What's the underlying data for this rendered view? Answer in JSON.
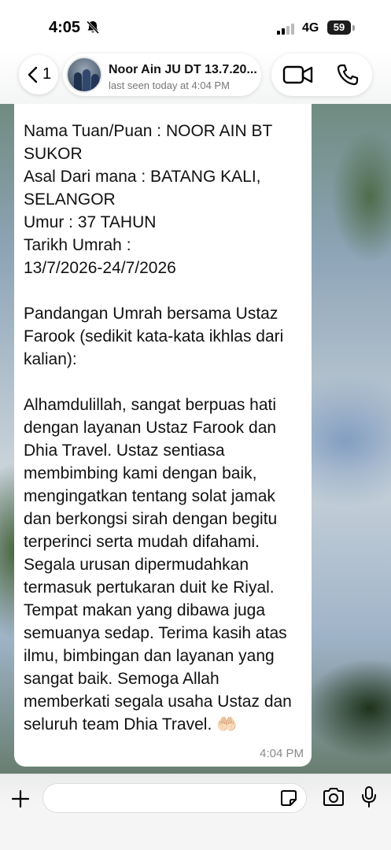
{
  "status_bar": {
    "time": "4:05",
    "network": "4G",
    "battery": "59"
  },
  "header": {
    "back_count": "1",
    "contact_name": "Noor Ain JU DT 13.7.20...",
    "contact_status": "last seen today at 4:04 PM"
  },
  "message": {
    "text": "Nama Tuan/Puan : NOOR AIN BT SUKOR\nAsal Dari mana : BATANG KALI, SELANGOR\nUmur : 37 TAHUN\nTarikh Umrah :\n13/7/2026-24/7/2026\n\nPandangan Umrah bersama Ustaz Farook (sedikit kata-kata ikhlas dari kalian):\n\nAlhamdulillah, sangat berpuas hati dengan layanan Ustaz Farook dan Dhia Travel. Ustaz sentiasa membimbing kami dengan baik, mengingatkan tentang solat jamak dan berkongsi sirah dengan begitu terperinci serta mudah difahami. Segala urusan dipermudahkan termasuk pertukaran duit ke Riyal. Tempat makan yang dibawa juga semuanya sedap. Terima kasih atas ilmu, bimbingan dan layanan yang sangat baik. Semoga Allah memberkati segala usaha Ustaz dan seluruh team Dhia Travel. 🤲🏻",
    "time": "4:04 PM"
  },
  "input": {
    "value": ""
  },
  "icons": {
    "silent": "bell-slash-icon",
    "back": "chevron-left-icon",
    "video": "video-camera-icon",
    "phone": "phone-icon",
    "attach": "plus-icon",
    "sticker": "sticker-icon",
    "camera": "camera-icon",
    "mic": "microphone-icon"
  }
}
